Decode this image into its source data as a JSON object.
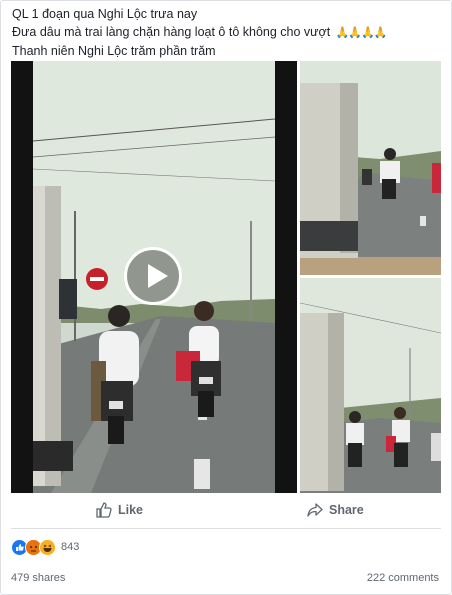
{
  "post": {
    "caption_lines": [
      "QL 1 đoạn qua Nghi Lộc trưa nay",
      "Đưa dâu mà trai làng chặn hàng loạt ô tô không cho vượt",
      "Thanh niên Nghi Lộc trăm phần trăm"
    ],
    "caption_emoji": "🙏🙏🙏🙏"
  },
  "actions": {
    "like_label": "Like",
    "share_label": "Share"
  },
  "reactions": {
    "count": "843",
    "types": [
      "like-icon",
      "angry-icon",
      "haha-icon"
    ]
  },
  "stats": {
    "shares": "479 shares",
    "comments": "222 comments"
  },
  "colors": {
    "text": "#1d2129",
    "muted": "#606770",
    "border": "#dddfe2",
    "like_blue": "#1877f2"
  }
}
